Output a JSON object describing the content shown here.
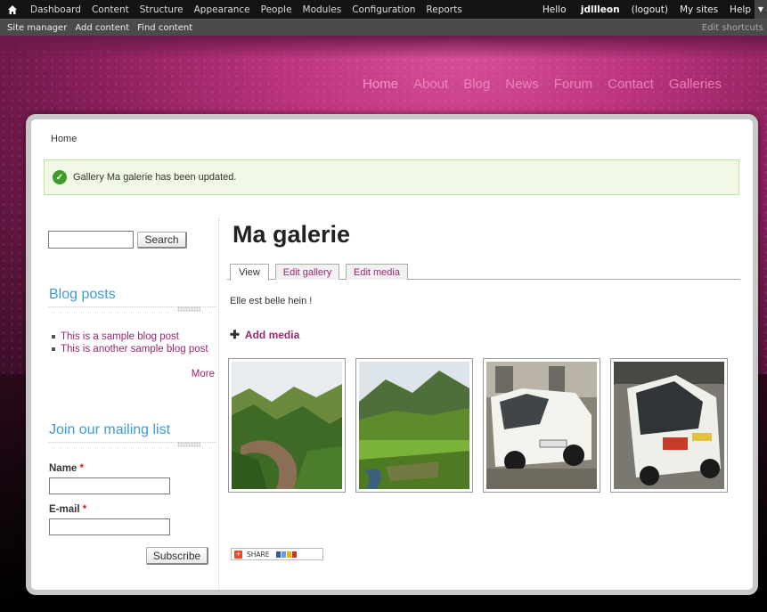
{
  "toolbar": {
    "items": [
      "Dashboard",
      "Content",
      "Structure",
      "Appearance",
      "People",
      "Modules",
      "Configuration",
      "Reports"
    ],
    "greeting": "Hello",
    "username": "jdllleon",
    "logout": "(logout)",
    "my_sites": "My sites",
    "help": "Help",
    "shortcuts": [
      "Site manager",
      "Add content",
      "Find content"
    ],
    "edit_shortcuts": "Edit shortcuts"
  },
  "main_nav": [
    "Home",
    "About",
    "Blog",
    "News",
    "Forum",
    "Contact",
    "Galleries"
  ],
  "breadcrumb": "Home",
  "status_message": "Gallery Ma galerie has been updated.",
  "sidebar": {
    "search_button": "Search",
    "blog_title": "Blog posts",
    "blog_posts": [
      "This is a sample blog post",
      "This is another sample blog post"
    ],
    "more": "More",
    "mailing_title": "Join our mailing list",
    "name_label": "Name",
    "email_label": "E-mail",
    "required_mark": "*",
    "subscribe_button": "Subscribe"
  },
  "content": {
    "title": "Ma galerie",
    "tabs": [
      "View",
      "Edit gallery",
      "Edit media"
    ],
    "description": "Elle est belle hein !",
    "add_media": "Add media",
    "thumbnails": [
      "landscape-river-valley",
      "landscape-green-valley",
      "white-car-front",
      "white-car-rear"
    ],
    "share_label": "SHARE"
  },
  "colors": {
    "accent": "#9b2672",
    "block_title": "#3d9ad7",
    "nav": "#f08ac0",
    "status_bg": "#f0f9e6"
  }
}
